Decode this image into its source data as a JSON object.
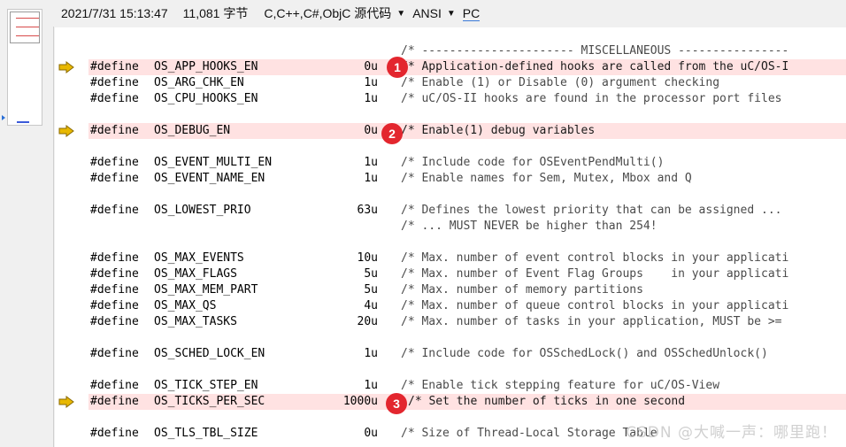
{
  "status": {
    "datetime": "2021/7/31 15:13:47",
    "size": "11,081 字节",
    "language": "C,C++,C#,ObjC 源代码",
    "encoding": "ANSI",
    "line_ending": "PC"
  },
  "lines": [
    {
      "define": "",
      "name": "",
      "value": "",
      "comment": "/* ---------------------- MISCELLANEOUS ----------------",
      "highlight": false,
      "arrow": false
    },
    {
      "define": "#define",
      "name": "OS_APP_HOOKS_EN",
      "value": "0u",
      "comment": "/* Application-defined hooks are called from the uC/OS-I",
      "highlight": true,
      "arrow": true
    },
    {
      "define": "#define",
      "name": "OS_ARG_CHK_EN",
      "value": "1u",
      "comment": "/* Enable (1) or Disable (0) argument checking",
      "highlight": false,
      "arrow": false
    },
    {
      "define": "#define",
      "name": "OS_CPU_HOOKS_EN",
      "value": "1u",
      "comment": "/* uC/OS-II hooks are found in the processor port files",
      "highlight": false,
      "arrow": false
    },
    {
      "define": "",
      "name": "",
      "value": "",
      "comment": "",
      "highlight": false,
      "arrow": false
    },
    {
      "define": "#define",
      "name": "OS_DEBUG_EN",
      "value": "0u",
      "comment": "/* Enable(1) debug variables",
      "highlight": true,
      "arrow": true
    },
    {
      "define": "",
      "name": "",
      "value": "",
      "comment": "",
      "highlight": false,
      "arrow": false
    },
    {
      "define": "#define",
      "name": "OS_EVENT_MULTI_EN",
      "value": "1u",
      "comment": "/* Include code for OSEventPendMulti()",
      "highlight": false,
      "arrow": false
    },
    {
      "define": "#define",
      "name": "OS_EVENT_NAME_EN",
      "value": "1u",
      "comment": "/* Enable names for Sem, Mutex, Mbox and Q",
      "highlight": false,
      "arrow": false
    },
    {
      "define": "",
      "name": "",
      "value": "",
      "comment": "",
      "highlight": false,
      "arrow": false
    },
    {
      "define": "#define",
      "name": "OS_LOWEST_PRIO",
      "value": "63u",
      "comment": "/* Defines the lowest priority that can be assigned ...",
      "highlight": false,
      "arrow": false
    },
    {
      "define": "",
      "name": "",
      "value": "",
      "comment": "/* ... MUST NEVER be higher than 254!",
      "highlight": false,
      "arrow": false
    },
    {
      "define": "",
      "name": "",
      "value": "",
      "comment": "",
      "highlight": false,
      "arrow": false
    },
    {
      "define": "#define",
      "name": "OS_MAX_EVENTS",
      "value": "10u",
      "comment": "/* Max. number of event control blocks in your applicati",
      "highlight": false,
      "arrow": false
    },
    {
      "define": "#define",
      "name": "OS_MAX_FLAGS",
      "value": "5u",
      "comment": "/* Max. number of Event Flag Groups    in your applicati",
      "highlight": false,
      "arrow": false
    },
    {
      "define": "#define",
      "name": "OS_MAX_MEM_PART",
      "value": "5u",
      "comment": "/* Max. number of memory partitions",
      "highlight": false,
      "arrow": false
    },
    {
      "define": "#define",
      "name": "OS_MAX_QS",
      "value": "4u",
      "comment": "/* Max. number of queue control blocks in your applicati",
      "highlight": false,
      "arrow": false
    },
    {
      "define": "#define",
      "name": "OS_MAX_TASKS",
      "value": "20u",
      "comment": "/* Max. number of tasks in your application, MUST be >=",
      "highlight": false,
      "arrow": false
    },
    {
      "define": "",
      "name": "",
      "value": "",
      "comment": "",
      "highlight": false,
      "arrow": false
    },
    {
      "define": "#define",
      "name": "OS_SCHED_LOCK_EN",
      "value": "1u",
      "comment": "/* Include code for OSSchedLock() and OSSchedUnlock()",
      "highlight": false,
      "arrow": false
    },
    {
      "define": "",
      "name": "",
      "value": "",
      "comment": "",
      "highlight": false,
      "arrow": false
    },
    {
      "define": "#define",
      "name": "OS_TICK_STEP_EN",
      "value": "1u",
      "comment": "/* Enable tick stepping feature for uC/OS-View",
      "highlight": false,
      "arrow": false
    },
    {
      "define": "#define",
      "name": "OS_TICKS_PER_SEC",
      "value": "1000u",
      "comment": "/* Set the number of ticks in one second",
      "highlight": true,
      "arrow": true
    },
    {
      "define": "",
      "name": "",
      "value": "",
      "comment": "",
      "highlight": false,
      "arrow": false
    },
    {
      "define": "#define",
      "name": "OS_TLS_TBL_SIZE",
      "value": "0u",
      "comment": "/* Size of Thread-Local Storage Table",
      "highlight": false,
      "arrow": false
    }
  ],
  "badges": [
    "1",
    "2",
    "3"
  ],
  "watermark": "CSDN @大喊一声：哪里跑！",
  "colors": {
    "highlight": "#ffe2e2",
    "badge": "#e3262e",
    "arrow": "#e8b800"
  }
}
